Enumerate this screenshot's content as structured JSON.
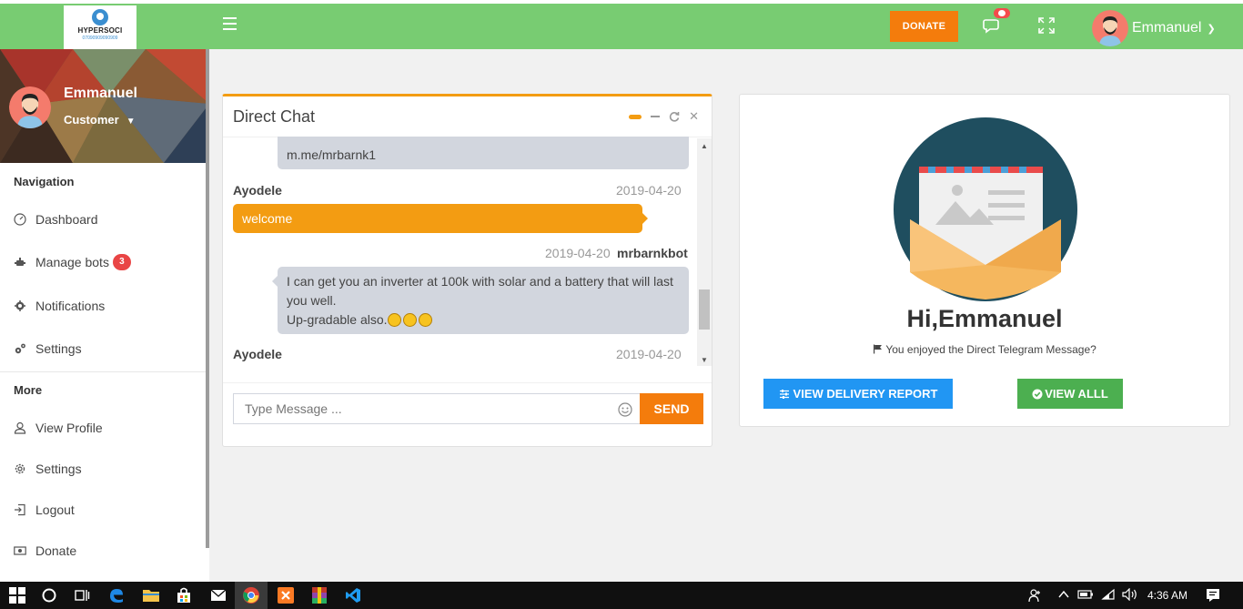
{
  "topbar": {
    "logo_text": "HYPERSOCI",
    "logo_sub": "07090909090909",
    "donate_label": "DONATE",
    "user_name": "Emmanuel",
    "icons": [
      "hamburger-icon",
      "chat-icon",
      "expand-icon",
      "chevron-down-icon"
    ],
    "color": "#78cc72"
  },
  "sidebar": {
    "profile_name": "Emmanuel",
    "profile_role": "Customer",
    "nav_heading": "Navigation",
    "nav_items": [
      {
        "label": "Dashboard",
        "icon": "dashboard-icon"
      },
      {
        "label": "Manage bots",
        "icon": "bot-icon",
        "badge": "3"
      },
      {
        "label": "Notifications",
        "icon": "bell-icon"
      },
      {
        "label": "Settings",
        "icon": "gears-icon"
      }
    ],
    "more_heading": "More",
    "more_items": [
      {
        "label": "View Profile",
        "icon": "user-icon"
      },
      {
        "label": "Settings",
        "icon": "gear-icon"
      },
      {
        "label": "Logout",
        "icon": "logout-icon"
      },
      {
        "label": "Donate",
        "icon": "money-icon"
      }
    ]
  },
  "chat": {
    "title": "Direct Chat",
    "messages": [
      {
        "text": "m.me/mrbarnk1"
      },
      {
        "name": "Ayodele",
        "date": "2019-04-20",
        "text": "welcome"
      },
      {
        "name": "mrbarnkbot",
        "date": "2019-04-20",
        "line1": "I can get you an inverter at 100k with solar and a battery that will last",
        "line2": "you well.",
        "line3": "Up-gradable also."
      },
      {
        "name": "Ayodele",
        "date": "2019-04-20"
      }
    ],
    "input_placeholder": "Type Message ...",
    "send_label": "SEND",
    "accent": "#f39c12"
  },
  "greeting": {
    "title": "Hi,Emmanuel",
    "subtitle": "You enjoyed the Direct Telegram Message?",
    "report_label": "VIEW DELIVERY REPORT",
    "all_label": "VIEW ALLL",
    "report_color": "#2196f3",
    "all_color": "#4caf50"
  },
  "taskbar": {
    "time": "4:36 AM"
  }
}
